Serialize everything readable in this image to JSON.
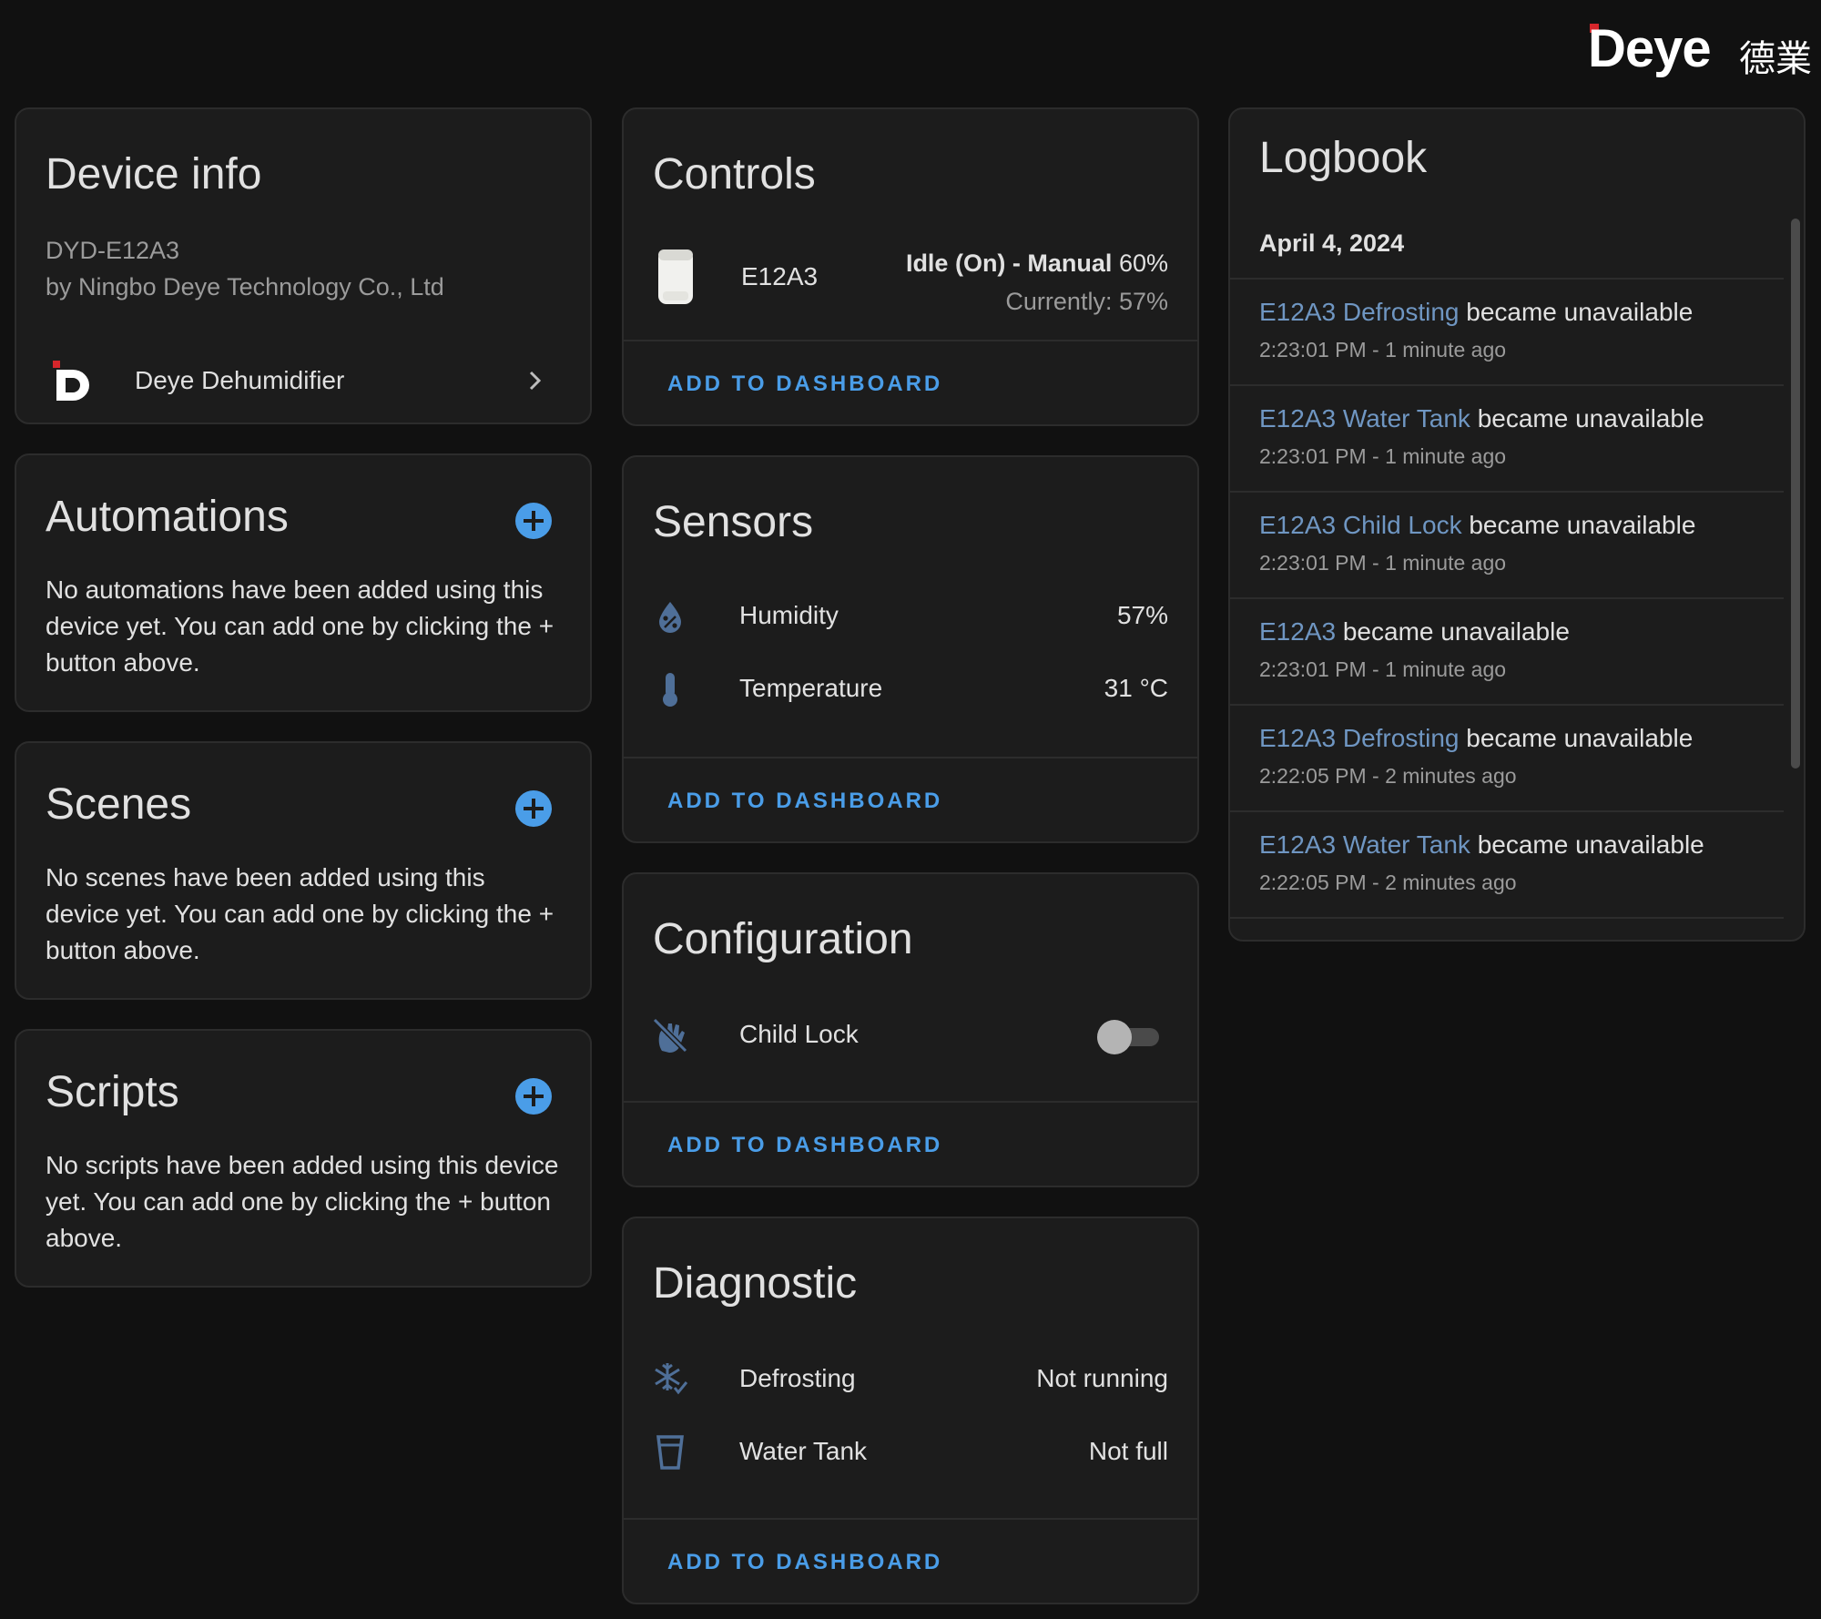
{
  "brand": {
    "name": "Deye",
    "chinese": "德業"
  },
  "device_info": {
    "title": "Device info",
    "model": "DYD-E12A3",
    "manufacturer": "by Ningbo Deye Technology Co., Ltd",
    "integration": "Deye Dehumidifier"
  },
  "automations": {
    "title": "Automations",
    "text": "No automations have been added using this device yet. You can add one by clicking the + button above."
  },
  "scenes": {
    "title": "Scenes",
    "text": "No scenes have been added using this device yet. You can add one by clicking the + button above."
  },
  "scripts": {
    "title": "Scripts",
    "text": "No scripts have been added using this device yet. You can add one by clicking the + button above."
  },
  "controls": {
    "title": "Controls",
    "entity": "E12A3",
    "state_strong": "Idle (On) - Manual",
    "state_target": "60%",
    "current": "Currently: 57%",
    "add_label": "ADD TO DASHBOARD"
  },
  "sensors": {
    "title": "Sensors",
    "items": [
      {
        "label": "Humidity",
        "value": "57%",
        "icon": "water-percent-icon"
      },
      {
        "label": "Temperature",
        "value": "31 °C",
        "icon": "thermometer-icon"
      }
    ],
    "add_label": "ADD TO DASHBOARD"
  },
  "configuration": {
    "title": "Configuration",
    "items": [
      {
        "label": "Child Lock",
        "state": "off",
        "icon": "hand-back-off-icon"
      }
    ],
    "add_label": "ADD TO DASHBOARD"
  },
  "diagnostic": {
    "title": "Diagnostic",
    "items": [
      {
        "label": "Defrosting",
        "value": "Not running",
        "icon": "snowflake-check-icon"
      },
      {
        "label": "Water Tank",
        "value": "Not full",
        "icon": "cup-water-icon"
      }
    ],
    "add_label": "ADD TO DASHBOARD"
  },
  "logbook": {
    "title": "Logbook",
    "date": "April 4, 2024",
    "entries": [
      {
        "entity": "E12A3 Defrosting",
        "message": "became unavailable",
        "time": "2:23:01 PM - 1 minute ago"
      },
      {
        "entity": "E12A3 Water Tank",
        "message": "became unavailable",
        "time": "2:23:01 PM - 1 minute ago"
      },
      {
        "entity": "E12A3 Child Lock",
        "message": "became unavailable",
        "time": "2:23:01 PM - 1 minute ago"
      },
      {
        "entity": "E12A3",
        "message": "became unavailable",
        "time": "2:23:01 PM - 1 minute ago"
      },
      {
        "entity": "E12A3 Defrosting",
        "message": "became unavailable",
        "time": "2:22:05 PM - 2 minutes ago"
      },
      {
        "entity": "E12A3 Water Tank",
        "message": "became unavailable",
        "time": "2:22:05 PM - 2 minutes ago"
      }
    ]
  },
  "colors": {
    "accent": "#4a9de8",
    "link": "#6f96c2",
    "icon": "#4f6f98",
    "background": "#111111",
    "card": "#1c1c1c",
    "brand_red": "#d6262b"
  }
}
